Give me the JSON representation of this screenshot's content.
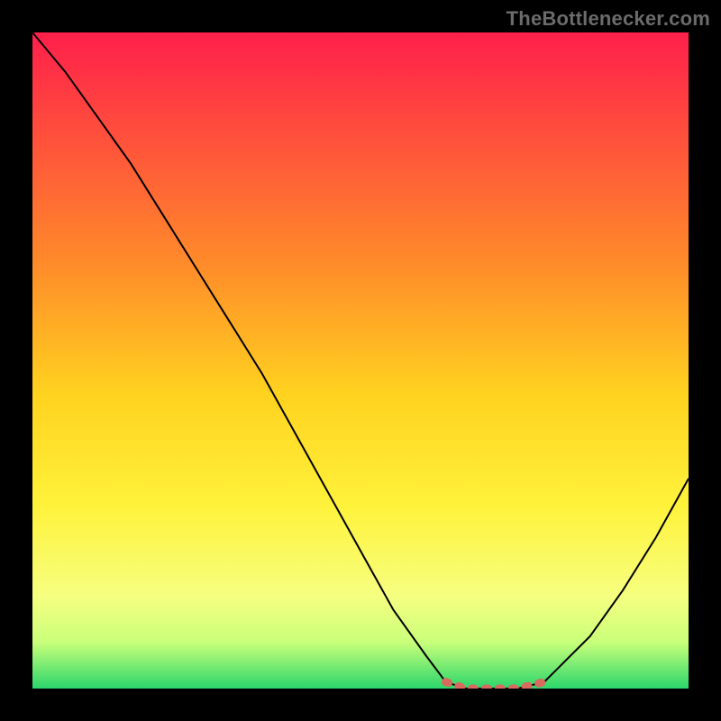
{
  "attribution": {
    "text": "TheBottlenecker.com"
  },
  "chart_data": {
    "type": "line",
    "title": "",
    "xlabel": "",
    "ylabel": "",
    "xlim": [
      0,
      100
    ],
    "ylim": [
      0,
      100
    ],
    "grid": false,
    "background": {
      "kind": "vertical-gradient",
      "stops": [
        {
          "pos": 0,
          "color": "#ff1f4b"
        },
        {
          "pos": 35,
          "color": "#ff8a2a"
        },
        {
          "pos": 55,
          "color": "#ffd21f"
        },
        {
          "pos": 72,
          "color": "#fff23a"
        },
        {
          "pos": 86,
          "color": "#f6ff80"
        },
        {
          "pos": 93,
          "color": "#c8ff7a"
        },
        {
          "pos": 100,
          "color": "#2bd66b"
        }
      ]
    },
    "series": [
      {
        "name": "bottleneck-curve",
        "color": "#000000",
        "x": [
          0,
          5,
          10,
          15,
          20,
          25,
          30,
          35,
          40,
          45,
          50,
          55,
          60,
          63,
          66,
          70,
          74,
          78,
          80,
          85,
          90,
          95,
          100
        ],
        "y": [
          100,
          94,
          87,
          80,
          72,
          64,
          56,
          48,
          39,
          30,
          21,
          12,
          5,
          1,
          0,
          0,
          0,
          1,
          3,
          8,
          15,
          23,
          32
        ]
      },
      {
        "name": "optimal-region",
        "color": "#d86a5e",
        "stroke_width": 9,
        "x": [
          63,
          66,
          70,
          74,
          78
        ],
        "y": [
          1,
          0,
          0,
          0,
          1
        ]
      }
    ],
    "annotations": []
  }
}
